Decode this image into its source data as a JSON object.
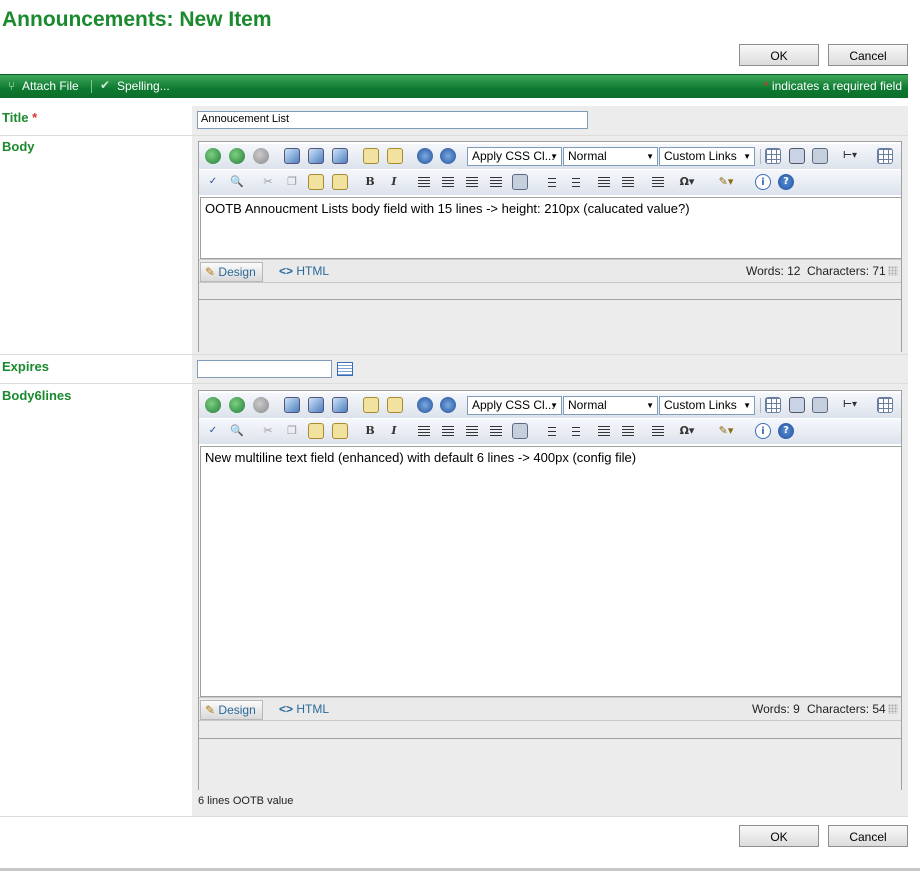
{
  "page": {
    "title": "Announcements: New Item"
  },
  "buttons": {
    "ok": "OK",
    "cancel": "Cancel"
  },
  "toolbar": {
    "attach": "Attach File",
    "spelling": "Spelling...",
    "required_star": "*",
    "required_note": " indicates a required field"
  },
  "fields": {
    "title": {
      "label": "Title",
      "star": "*",
      "value": "Annoucement List"
    },
    "body": {
      "label": "Body",
      "css_dropdown": "Apply CSS Cl...",
      "style_dropdown": "Normal",
      "links_dropdown": "Custom Links",
      "content": "OOTB Annoucment Lists body field with 15 lines -> height: 210px (calucated value?)",
      "design_tab": "Design",
      "html_tab": "HTML",
      "words": "Words: 12",
      "characters": "Characters: 71"
    },
    "expires": {
      "label": "Expires",
      "value": ""
    },
    "body6lines": {
      "label": "Body6lines",
      "css_dropdown": "Apply CSS Cl...",
      "style_dropdown": "Normal",
      "links_dropdown": "Custom Links",
      "content": "New multiline text field (enhanced) with default 6 lines -> 400px (config file)",
      "design_tab": "Design",
      "html_tab": "HTML",
      "words": "Words: 9",
      "characters": "Characters: 54",
      "description": "6 lines OOTB value"
    }
  },
  "icons": {
    "attach": "paperclip-icon",
    "spelling": "spellcheck-icon",
    "calendar": "calendar-icon",
    "design": "pencil-icon",
    "html": "code-icon"
  },
  "colors": {
    "accent": "#1a8a2e",
    "toolbar": "#0d7a30",
    "required": "#e03030"
  }
}
